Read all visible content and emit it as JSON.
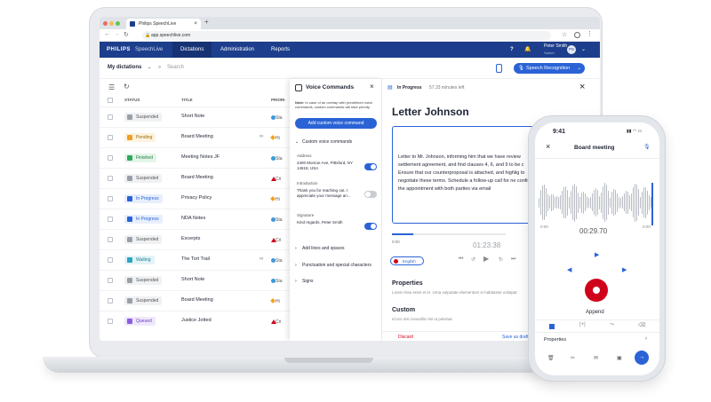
{
  "browser": {
    "tab_title": "Philips SpeechLive",
    "url": "app.speechlive.com"
  },
  "appbar": {
    "brand": "PHILIPS",
    "product": "SpeechLive",
    "nav": [
      "Dictations",
      "Administration",
      "Reports"
    ],
    "user_name": "Peter Smith",
    "user_sub": "Switch",
    "user_initials": "PS",
    "help": "?"
  },
  "toolbar": {
    "folder": "My dictations",
    "search_placeholder": "Search",
    "speech_button": "Speech Recognition"
  },
  "table": {
    "headers": [
      "STATUS",
      "TITLE",
      "PRIORI"
    ],
    "rows": [
      {
        "status": "Suspended",
        "title": "Short Note",
        "priority": "Sta"
      },
      {
        "status": "Pending",
        "title": "Board Meeting",
        "priority": "Hi"
      },
      {
        "status": "Finished",
        "title": "Meeting Notes JF",
        "priority": "Sta"
      },
      {
        "status": "Suspended",
        "title": "Board Meeting",
        "priority": "Cri"
      },
      {
        "status": "In Progress",
        "title": "Privacy Policy",
        "priority": "Hi"
      },
      {
        "status": "In Progress",
        "title": "NDA Notes",
        "priority": "Sta"
      },
      {
        "status": "Suspended",
        "title": "Excerpts",
        "priority": "Cri"
      },
      {
        "status": "Waiting",
        "title": "The Tort Trail",
        "priority": "Sta"
      },
      {
        "status": "Suspended",
        "title": "Short Note",
        "priority": "Sta"
      },
      {
        "status": "Suspended",
        "title": "Board Meeting",
        "priority": "Hi"
      },
      {
        "status": "Queued",
        "title": "Justice Jotted",
        "priority": "Cri"
      }
    ]
  },
  "voice_panel": {
    "title": "Voice Commands",
    "note_bold": "Note:",
    "note": "In case of an overlap with predefined voice commands, custom commands will take priority.",
    "add_button": "Add custom voice command",
    "section": "Custom voice commands",
    "items": [
      {
        "label": "Address",
        "value": "2400 Monroe Ave, Pittsford, NY 14618, USA",
        "on": true
      },
      {
        "label": "Introduction",
        "value": "Thank you for reaching out. I appreciate your message an...",
        "on": false
      },
      {
        "label": "Signature",
        "value": "Kind regards, Peter Smith",
        "on": true
      }
    ],
    "groups": [
      "Add lines and spaces",
      "Punctuation and special characters",
      "Signs"
    ]
  },
  "editor": {
    "status": "In Progress",
    "time_left": "57.33 minutes left",
    "title": "Letter Johnson",
    "body": "Letter to Mr. Johnson, informing him that we have review settlement agreement, and find clauses 4, 6, and 9 to be c Ensure that our counterproposal is attached, and highlig to negotiate these terms. Schedule a follow-up call for ne confirm the appointment with both parties via email",
    "pos": "0:00",
    "time": "01:23.38",
    "language": "English",
    "properties_title": "Properties",
    "properties_text": "Lorem hisu enim et in. Urna vulputate elementum in habitasse volutpat",
    "custom_title": "Custom",
    "custom_text": "Id uro nisi convallis nisi ut pulvinar",
    "discard": "Discard",
    "save": "Save as draft"
  },
  "phone": {
    "clock": "9:41",
    "title": "Board meeting",
    "start": "0:00",
    "end": "0:00",
    "time": "00:29.70",
    "append": "Append",
    "properties": "Properties"
  },
  "colors": {
    "brand": "#1d3e8c",
    "accent": "#2a63d6",
    "record": "#d0021b"
  }
}
